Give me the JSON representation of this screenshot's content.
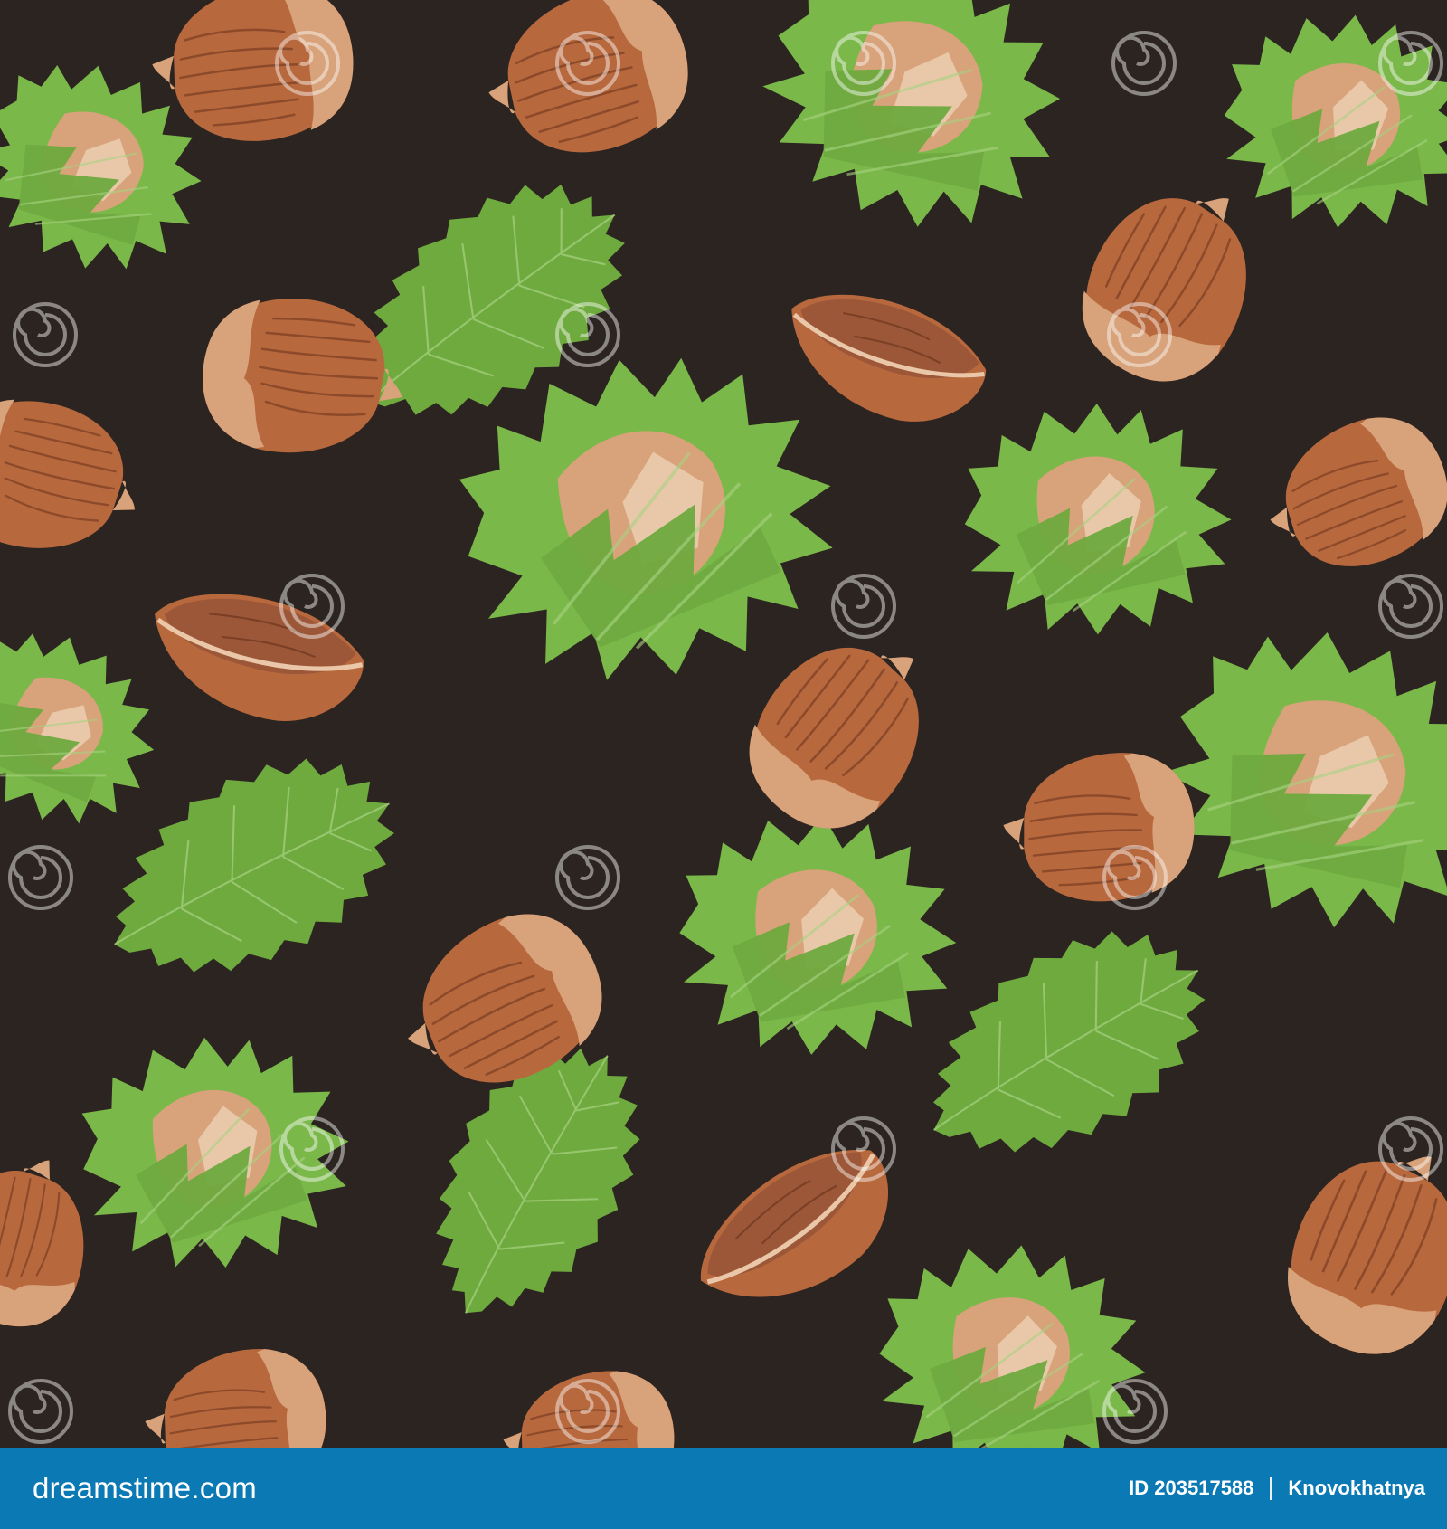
{
  "image": {
    "background_color": "#2c2421",
    "subject": "seamless pattern of hazelnuts, husks and leaves"
  },
  "colors": {
    "nut_shell": "#b8683d",
    "nut_shell_dark": "#8c4a2a",
    "nut_cap": "#d8a27a",
    "kernel": "#9c5738",
    "leaf": "#6faa3f",
    "leaf_light": "#8fc45a",
    "husk": "#7bb84a",
    "watermark": "#ffffff"
  },
  "watermark": {
    "text": "dreamstime",
    "icon": "spiral-icon"
  },
  "footer": {
    "brand_prefix": "dreams",
    "brand_suffix": "time.com",
    "id_label": "ID 203517588",
    "author": "Knovokhatnya",
    "background_color": "#0b79b4"
  }
}
